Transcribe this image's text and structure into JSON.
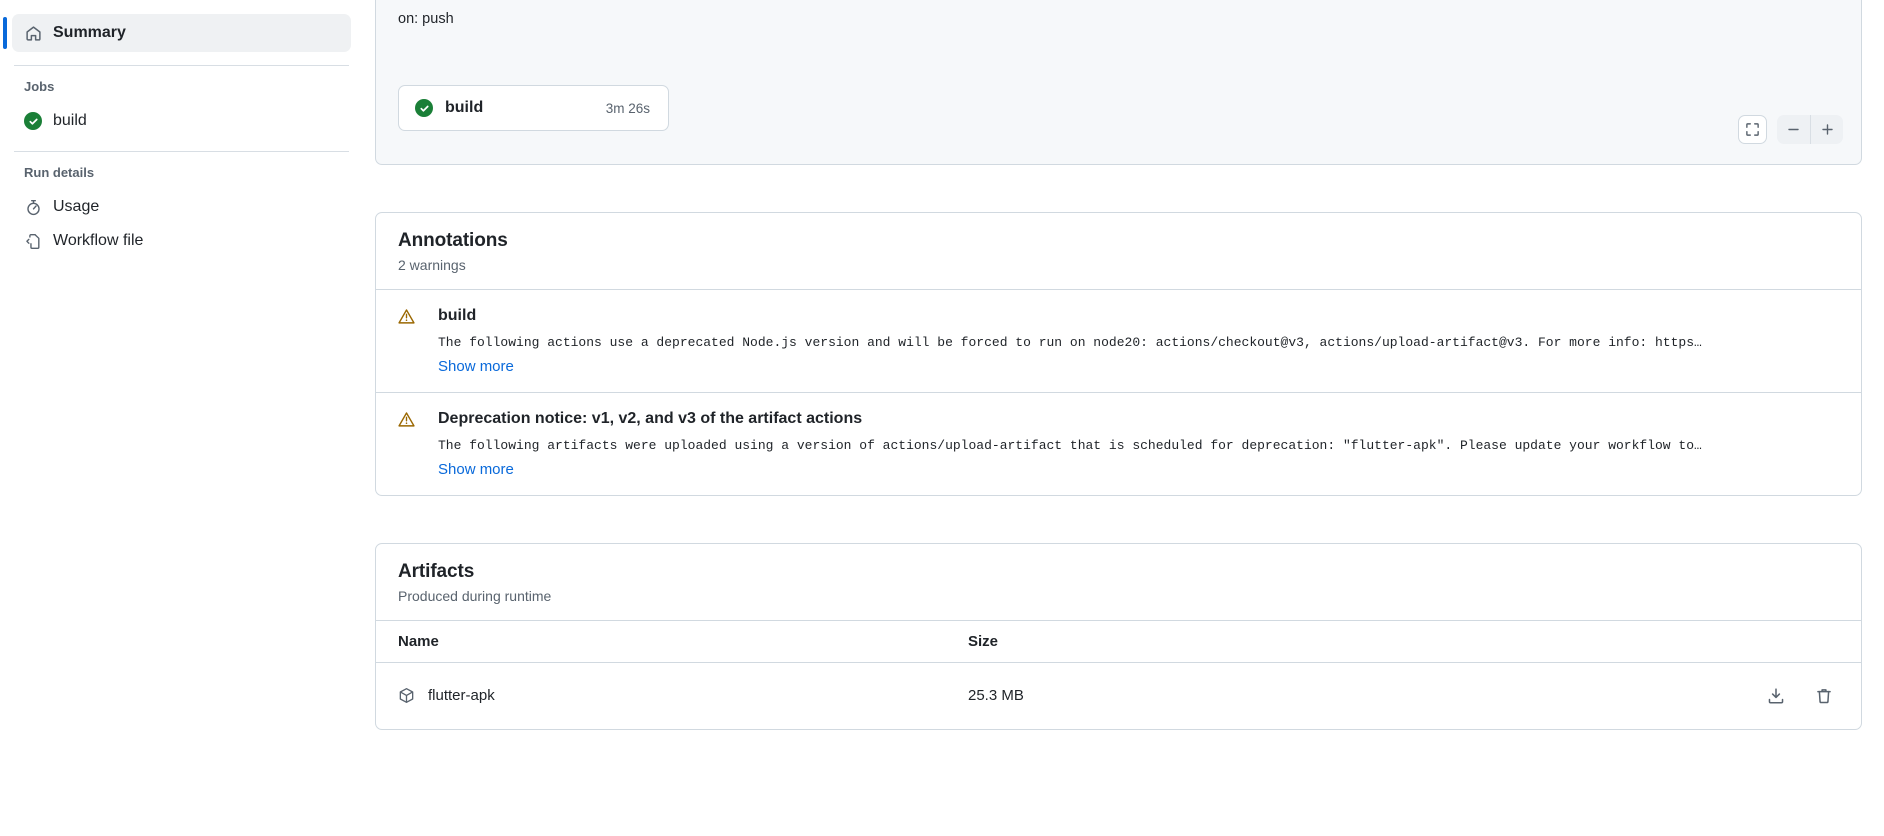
{
  "sidebar": {
    "summary": {
      "label": "Summary",
      "icon": "home-icon"
    },
    "jobs_group_title": "Jobs",
    "jobs": [
      {
        "label": "build",
        "status": "success"
      }
    ],
    "run_details_group_title": "Run details",
    "run_details": [
      {
        "label": "Usage",
        "icon": "stopwatch-icon"
      },
      {
        "label": "Workflow file",
        "icon": "code-file-icon"
      }
    ]
  },
  "graph": {
    "trigger": "on: push",
    "job_node": {
      "name": "build",
      "duration": "3m 26s",
      "status": "success"
    },
    "controls": {
      "fit_label": "fit-screen-icon",
      "zoom_out_label": "−",
      "zoom_in_label": "+"
    }
  },
  "annotations": {
    "title": "Annotations",
    "subtitle": "2 warnings",
    "items": [
      {
        "title": "build",
        "text": "The following actions use a deprecated Node.js version and will be forced to run on node20: actions/checkout@v3, actions/upload-artifact@v3. For more info: https…",
        "show_more": "Show more",
        "severity": "warning"
      },
      {
        "title": "Deprecation notice: v1, v2, and v3 of the artifact actions",
        "text": "The following artifacts were uploaded using a version of actions/upload-artifact that is scheduled for deprecation: \"flutter-apk\". Please update your workflow to…",
        "show_more": "Show more",
        "severity": "warning"
      }
    ]
  },
  "artifacts": {
    "title": "Artifacts",
    "subtitle": "Produced during runtime",
    "columns": {
      "name": "Name",
      "size": "Size"
    },
    "rows": [
      {
        "name": "flutter-apk",
        "size": "25.3 MB",
        "download_label": "download-icon",
        "delete_label": "trash-icon"
      }
    ]
  },
  "colors": {
    "accent": "#0969da",
    "success": "#1a7f37",
    "warning": "#9a6700",
    "border": "#d1d9e0",
    "muted_text": "#59636e"
  }
}
